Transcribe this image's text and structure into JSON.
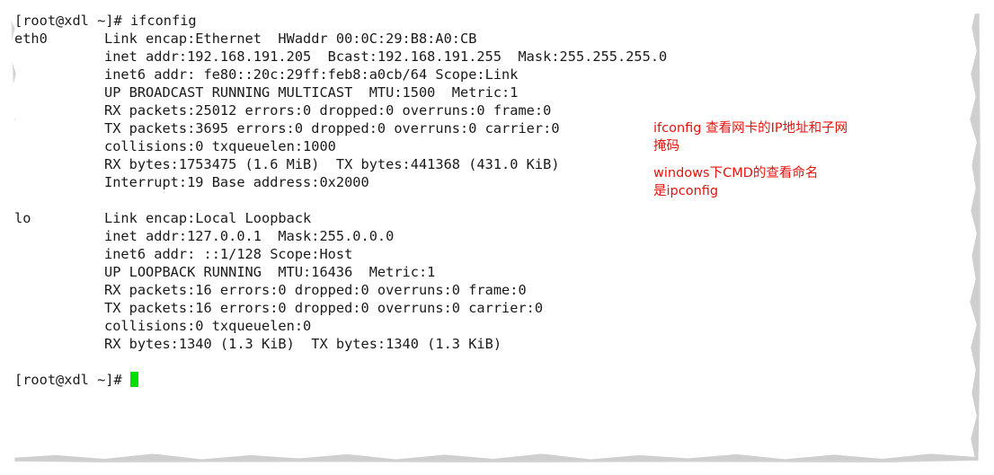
{
  "prompt": "[root@xdl ~]#",
  "command": "ifconfig",
  "interfaces": [
    {
      "name": "eth0",
      "lines": [
        "Link encap:Ethernet  HWaddr 00:0C:29:B8:A0:CB",
        "inet addr:192.168.191.205  Bcast:192.168.191.255  Mask:255.255.255.0",
        "inet6 addr: fe80::20c:29ff:feb8:a0cb/64 Scope:Link",
        "UP BROADCAST RUNNING MULTICAST  MTU:1500  Metric:1",
        "RX packets:25012 errors:0 dropped:0 overruns:0 frame:0",
        "TX packets:3695 errors:0 dropped:0 overruns:0 carrier:0",
        "collisions:0 txqueuelen:1000",
        "RX bytes:1753475 (1.6 MiB)  TX bytes:441368 (431.0 KiB)",
        "Interrupt:19 Base address:0x2000"
      ]
    },
    {
      "name": "lo",
      "lines": [
        "Link encap:Local Loopback",
        "inet addr:127.0.0.1  Mask:255.0.0.0",
        "inet6 addr: ::1/128 Scope:Host",
        "UP LOOPBACK RUNNING  MTU:16436  Metric:1",
        "RX packets:16 errors:0 dropped:0 overruns:0 frame:0",
        "TX packets:16 errors:0 dropped:0 overruns:0 carrier:0",
        "collisions:0 txqueuelen:0",
        "RX bytes:1340 (1.3 KiB)  TX bytes:1340 (1.3 KiB)"
      ]
    }
  ],
  "annotations": {
    "note1": "ifconfig 查看网卡的IP地址和子网\n掩码",
    "note2": "windows下CMD的查看命名\n是ipconfig"
  },
  "colors": {
    "cursor": "#00e000",
    "annotation": "#e4140c",
    "text": "#1a1a1a"
  }
}
